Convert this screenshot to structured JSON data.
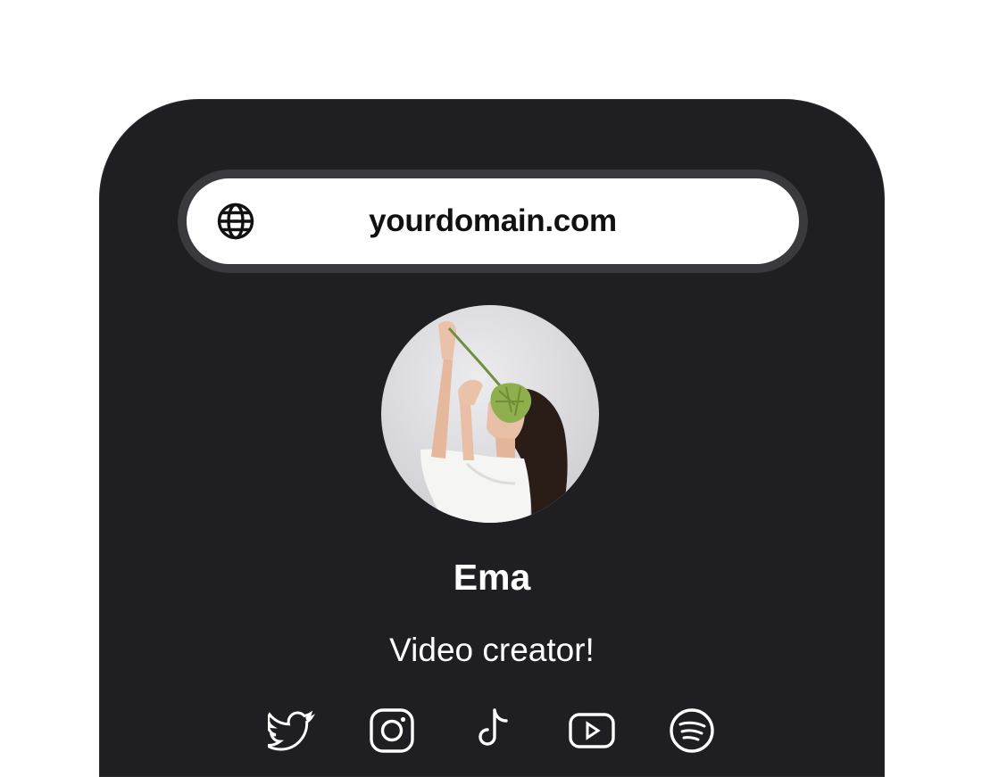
{
  "browser": {
    "url": "yourdomain.com",
    "icon": "globe-icon"
  },
  "profile": {
    "name": "Ema",
    "bio": "Video creator!",
    "avatar": "avatar-photo"
  },
  "social_links": [
    {
      "icon": "twitter-icon"
    },
    {
      "icon": "instagram-icon"
    },
    {
      "icon": "tiktok-icon"
    },
    {
      "icon": "youtube-icon"
    },
    {
      "icon": "spotify-icon"
    }
  ],
  "colors": {
    "page_background": "#ffffff",
    "phone_background": "#1f1e22",
    "url_bar": "#ffffff",
    "url_bar_ring": "#3a393e",
    "text_primary": "#ffffff"
  }
}
